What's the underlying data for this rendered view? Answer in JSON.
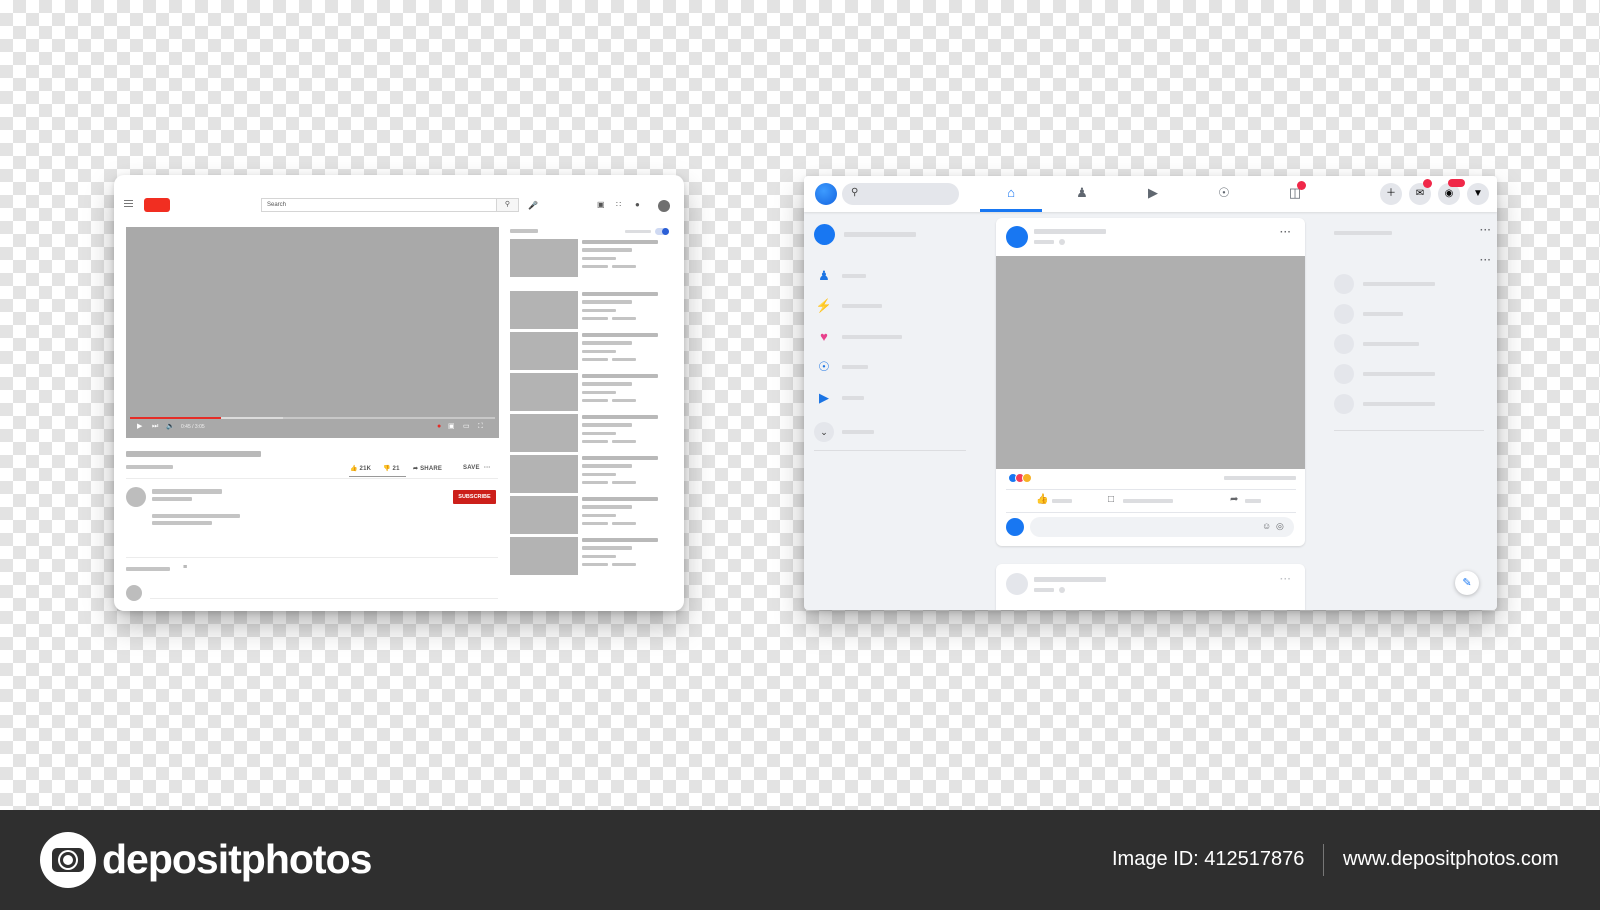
{
  "youtube": {
    "search_placeholder": "Search",
    "search_icon": "magnifier-icon",
    "time_display": "0:45 / 3:05",
    "progress_played_fraction": 0.25,
    "progress_buffered_fraction": 0.42,
    "likes": "21K",
    "dislikes": "21",
    "share_label": "SHARE",
    "save_label": "SAVE",
    "more_label": "···",
    "subscribe_label": "SUBSCRIBE",
    "recommended_count": 8,
    "colors": {
      "brand_red": "#f12e21",
      "subscribe_red": "#cc1f1a"
    }
  },
  "facebook": {
    "nav_icons": [
      "home-icon",
      "friends-icon",
      "watch-icon",
      "groups-icon",
      "pages-icon"
    ],
    "more_dots": "···",
    "colors": {
      "brand_blue": "#1877f2",
      "badge_red": "#f02849"
    }
  },
  "footer": {
    "brand": "depositphotos",
    "image_id": "Image ID: 412517876",
    "website": "www.depositphotos.com"
  }
}
